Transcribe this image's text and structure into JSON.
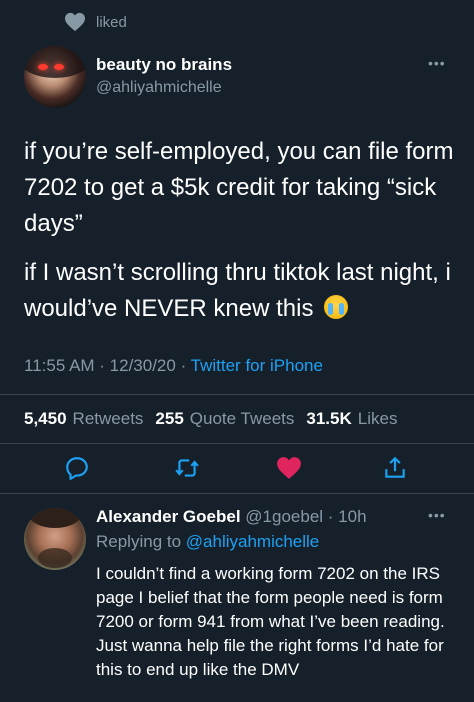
{
  "context": {
    "icon": "heart-icon",
    "text": "liked"
  },
  "tweet": {
    "author_name": "beauty no brains",
    "author_handle": "@ahliyahmichelle",
    "more_label": "•••",
    "paragraph1": "if you’re self-employed, you can file form 7202 to get a $5k credit for taking “sick days”",
    "paragraph2": "if I wasn’t scrolling thru tiktok last night, i would’ve NEVER knew this",
    "emoji": "loudly-crying-face",
    "time": "11:55 AM · 12/30/20 · ",
    "source": "Twitter for iPhone",
    "stats": {
      "retweets_count": "5,450",
      "retweets_label": "Retweets",
      "quotes_count": "255",
      "quotes_label": "Quote Tweets",
      "likes_count": "31.5K",
      "likes_label": "Likes"
    },
    "actions": {
      "reply_icon": "reply-icon",
      "retweet_icon": "retweet-icon",
      "like_icon": "heart-icon",
      "share_icon": "share-icon"
    }
  },
  "reply": {
    "author_name": "Alexander Goebel",
    "author_handle": "@1goebel",
    "age": "10h",
    "more_label": "•••",
    "replying_prefix": "Replying to ",
    "replying_handle": "@ahliyahmichelle",
    "body": "I couldn’t find a working form 7202 on the IRS page I belief that the form people need is form 7200 or form 941 from what I’ve been reading. Just wanna help file the right forms I’d hate for this to end up like the DMV"
  },
  "colors": {
    "background": "#15202b",
    "text_secondary": "#8899a6",
    "link": "#1da1f2",
    "like": "#e0245e",
    "divider": "#38444d"
  }
}
